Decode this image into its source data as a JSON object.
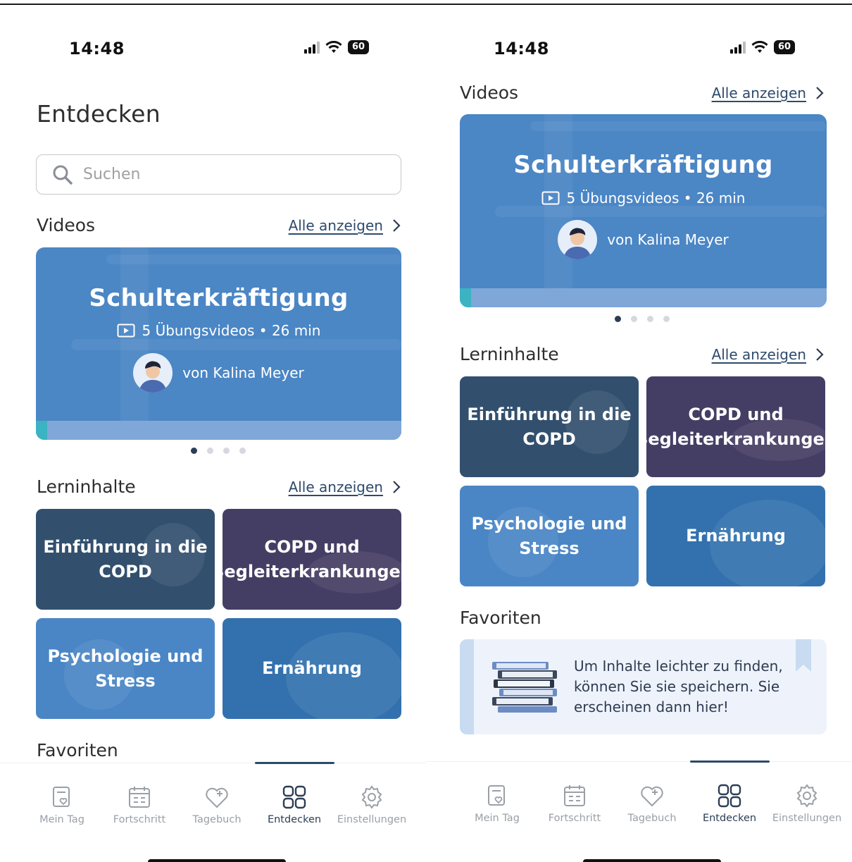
{
  "status_bar": {
    "time": "14:48",
    "battery": "60"
  },
  "left": {
    "page_title": "Entdecken",
    "search_placeholder": "Suchen",
    "videos": {
      "title": "Videos",
      "see_all": "Alle anzeigen",
      "card_title": "Schulterkräftigung",
      "card_meta": "5 Übungsvideos • 26 min",
      "card_author": "von Kalina Meyer",
      "progress": 0.03,
      "pagination": {
        "total": 4,
        "active": 0
      }
    },
    "learning": {
      "title": "Lerninhalte",
      "see_all": "Alle anzeigen",
      "tiles": [
        {
          "label": "Einführung in die COPD",
          "color": "#32506e"
        },
        {
          "label": "COPD und Begleiterkrankungen",
          "color": "#453e64"
        },
        {
          "label": "Psychologie und Stress",
          "color": "#4a86c5"
        },
        {
          "label": "Ernährung",
          "color": "#3271ae"
        }
      ]
    },
    "favorites": {
      "title": "Favoriten"
    }
  },
  "right": {
    "videos": {
      "title": "Videos",
      "see_all": "Alle anzeigen",
      "card_title": "Schulterkräftigung",
      "card_meta": "5 Übungsvideos • 26 min",
      "card_author": "von Kalina Meyer",
      "progress": 0.03,
      "pagination": {
        "total": 4,
        "active": 0
      }
    },
    "learning": {
      "title": "Lerninhalte",
      "see_all": "Alle anzeigen",
      "tiles": [
        {
          "label": "Einführung in die COPD",
          "color": "#32506e"
        },
        {
          "label": "COPD und Begleiterkrankungen",
          "color": "#453e64"
        },
        {
          "label": "Psychologie und Stress",
          "color": "#4a86c5"
        },
        {
          "label": "Ernährung",
          "color": "#3271ae"
        }
      ]
    },
    "favorites": {
      "title": "Favoriten",
      "empty_message": "Um Inhalte leichter zu finden, können Sie sie speichern. Sie erscheinen dann hier!"
    }
  },
  "nav": {
    "items": [
      {
        "label": "Mein Tag",
        "icon": "calendar-heart-icon"
      },
      {
        "label": "Fortschritt",
        "icon": "calendar-grid-icon"
      },
      {
        "label": "Tagebuch",
        "icon": "heart-plus-icon"
      },
      {
        "label": "Entdecken",
        "icon": "grid-icon"
      },
      {
        "label": "Einstellungen",
        "icon": "gear-icon"
      }
    ],
    "active_index": 3
  },
  "colors": {
    "accent": "#2c3e55",
    "video_card": "#4b86c5",
    "progress": "#3bb3c3"
  }
}
